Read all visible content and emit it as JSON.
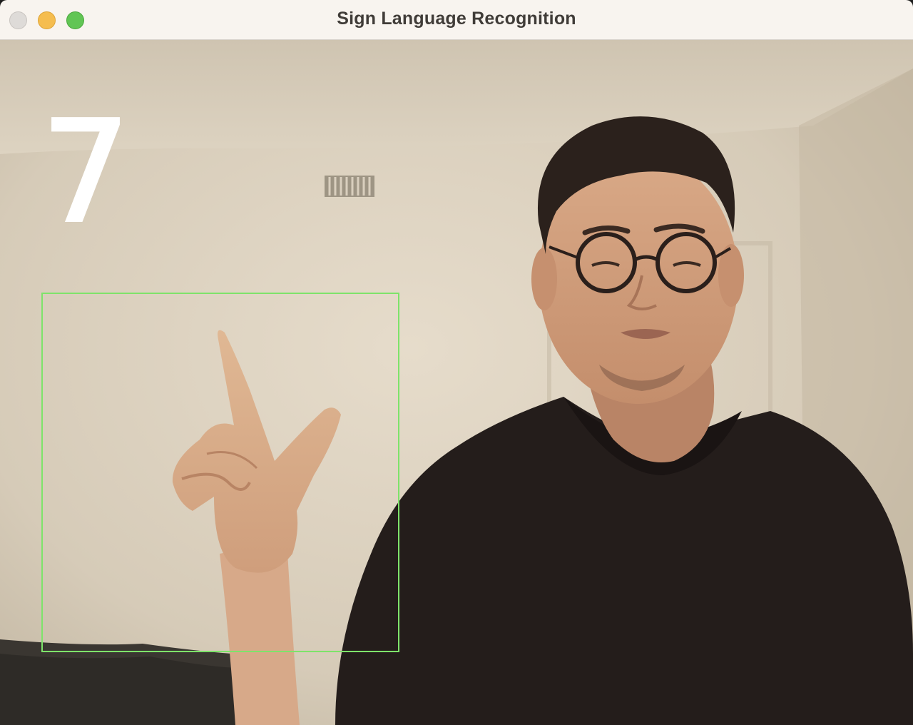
{
  "window": {
    "title": "Sign Language Recognition",
    "controls": [
      "close-icon",
      "minimize-icon",
      "zoom-icon"
    ]
  },
  "feed": {
    "predicted_sign": "7"
  },
  "colors": {
    "roi_box": "#7ee36a",
    "prediction_text": "#ffffff",
    "titlebar": "#f8f4ef"
  }
}
